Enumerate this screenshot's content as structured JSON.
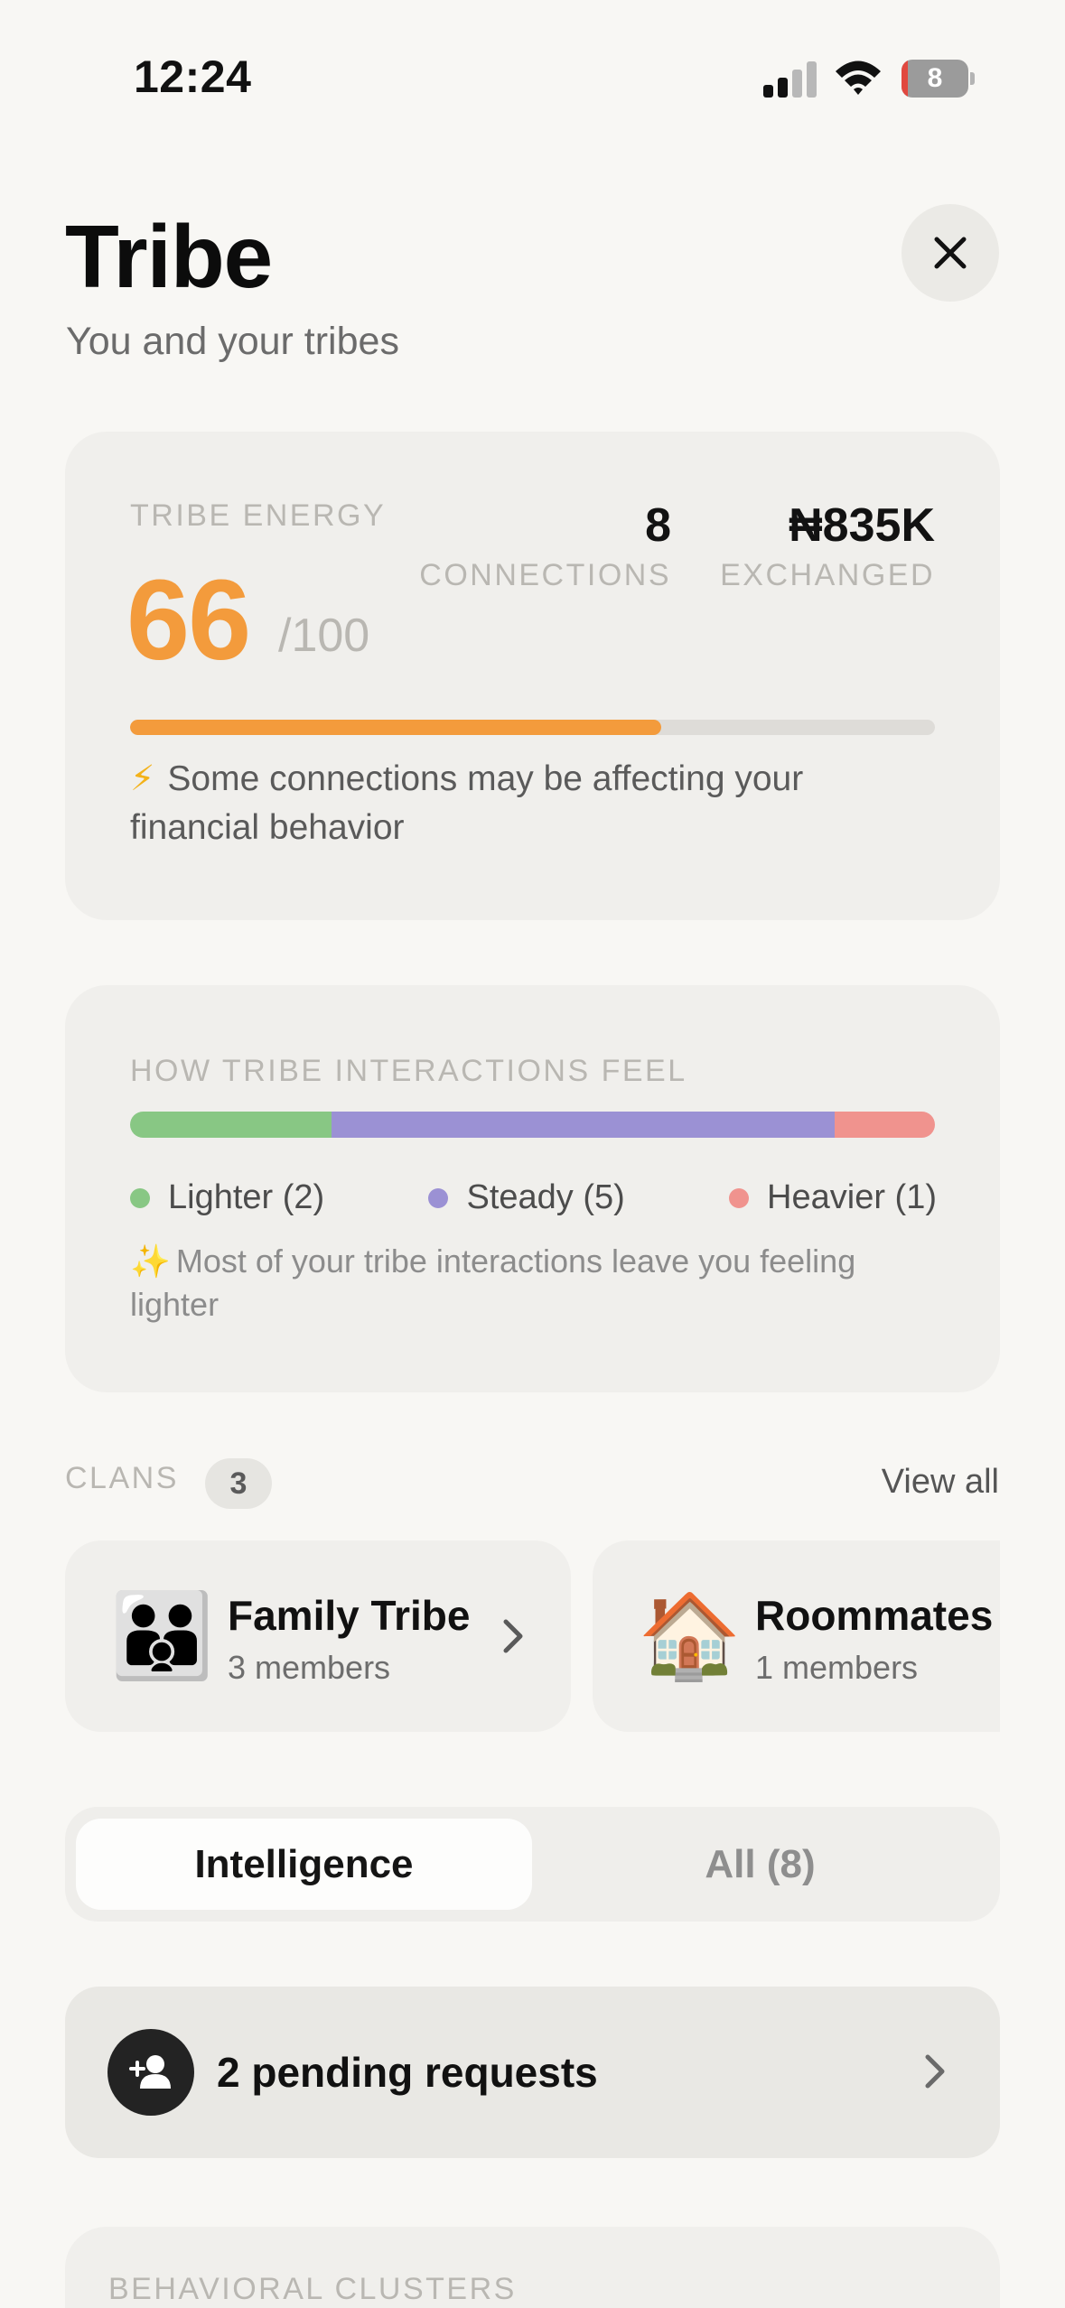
{
  "status_bar": {
    "time": "12:24",
    "battery_level": "8",
    "signal_bars_active": 2,
    "icons": [
      "signal-icon",
      "wifi-icon",
      "battery-icon"
    ]
  },
  "header": {
    "title": "Tribe",
    "subtitle": "You and your tribes",
    "close_icon": "close-icon"
  },
  "tribe_energy": {
    "label": "TRIBE ENERGY",
    "score": "66",
    "max": "/100",
    "progress": 0.66,
    "connections_value": "8",
    "connections_label": "CONNECTIONS",
    "exchanged_value": "₦835K",
    "exchanged_label": "EXCHANGED",
    "note_icon": "⚡",
    "note": "Some connections may be affecting your financial behavior",
    "accent_color": "#f39b3c"
  },
  "interactions": {
    "title": "HOW TRIBE INTERACTIONS FEEL",
    "segments": [
      {
        "label": "Lighter (2)",
        "count": 2,
        "color": "#88c784"
      },
      {
        "label": "Steady (5)",
        "count": 5,
        "color": "#9b91d4"
      },
      {
        "label": "Heavier (1)",
        "count": 1,
        "color": "#f0938e"
      }
    ],
    "note_icon": "✨",
    "note": "Most of your tribe interactions leave you feeling lighter"
  },
  "clans": {
    "title": "CLANS",
    "count": "3",
    "view_all": "View all",
    "items": [
      {
        "emoji": "👪",
        "icon": "family-icon",
        "name": "Family Tribe",
        "members": "3 members"
      },
      {
        "emoji": "🏠",
        "icon": "house-icon",
        "name": "Roommates",
        "members": "1 members"
      }
    ]
  },
  "tabs": {
    "intelligence": "Intelligence",
    "all": "All (8)",
    "selected": "Intelligence"
  },
  "pending": {
    "label": "2 pending requests",
    "icon": "add-user-icon"
  },
  "clusters": {
    "title": "BEHAVIORAL CLUSTERS"
  }
}
